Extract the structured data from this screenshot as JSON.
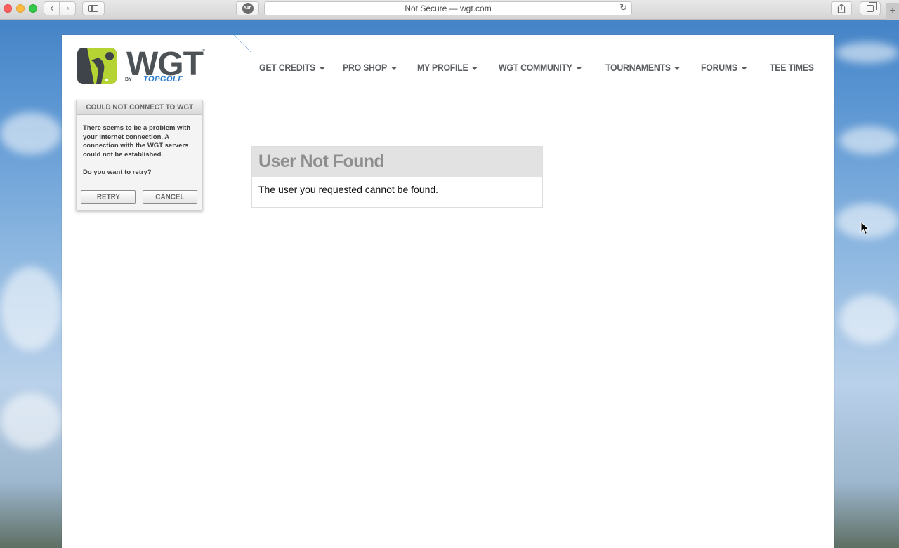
{
  "browser": {
    "address_text": "Not Secure — wgt.com",
    "adblock_label": "ABP"
  },
  "logo": {
    "brand": "WGT",
    "trademark": "™",
    "by": "BY",
    "partner": "TOPGOLF"
  },
  "nav": {
    "items": [
      {
        "label": "GET CREDITS",
        "has_dropdown": true
      },
      {
        "label": "PRO SHOP",
        "has_dropdown": true
      },
      {
        "label": "MY PROFILE",
        "has_dropdown": true
      },
      {
        "label": "WGT COMMUNITY",
        "has_dropdown": true
      },
      {
        "label": "TOURNAMENTS",
        "has_dropdown": true
      },
      {
        "label": "FORUMS",
        "has_dropdown": true
      },
      {
        "label": "TEE TIMES",
        "has_dropdown": false
      }
    ]
  },
  "connection_dialog": {
    "title": "COULD NOT CONNECT TO WGT",
    "message": "There seems to be a problem with your internet connection. A connection with the WGT servers could not be established.",
    "question": "Do you want to retry?",
    "retry_label": "RETRY",
    "cancel_label": "CANCEL"
  },
  "error_box": {
    "title": "User Not Found",
    "message": "The user you requested cannot be found."
  },
  "colors": {
    "brand_green": "#b6d334",
    "brand_gray": "#4d5257",
    "topgolf_blue": "#2a7ac9"
  }
}
